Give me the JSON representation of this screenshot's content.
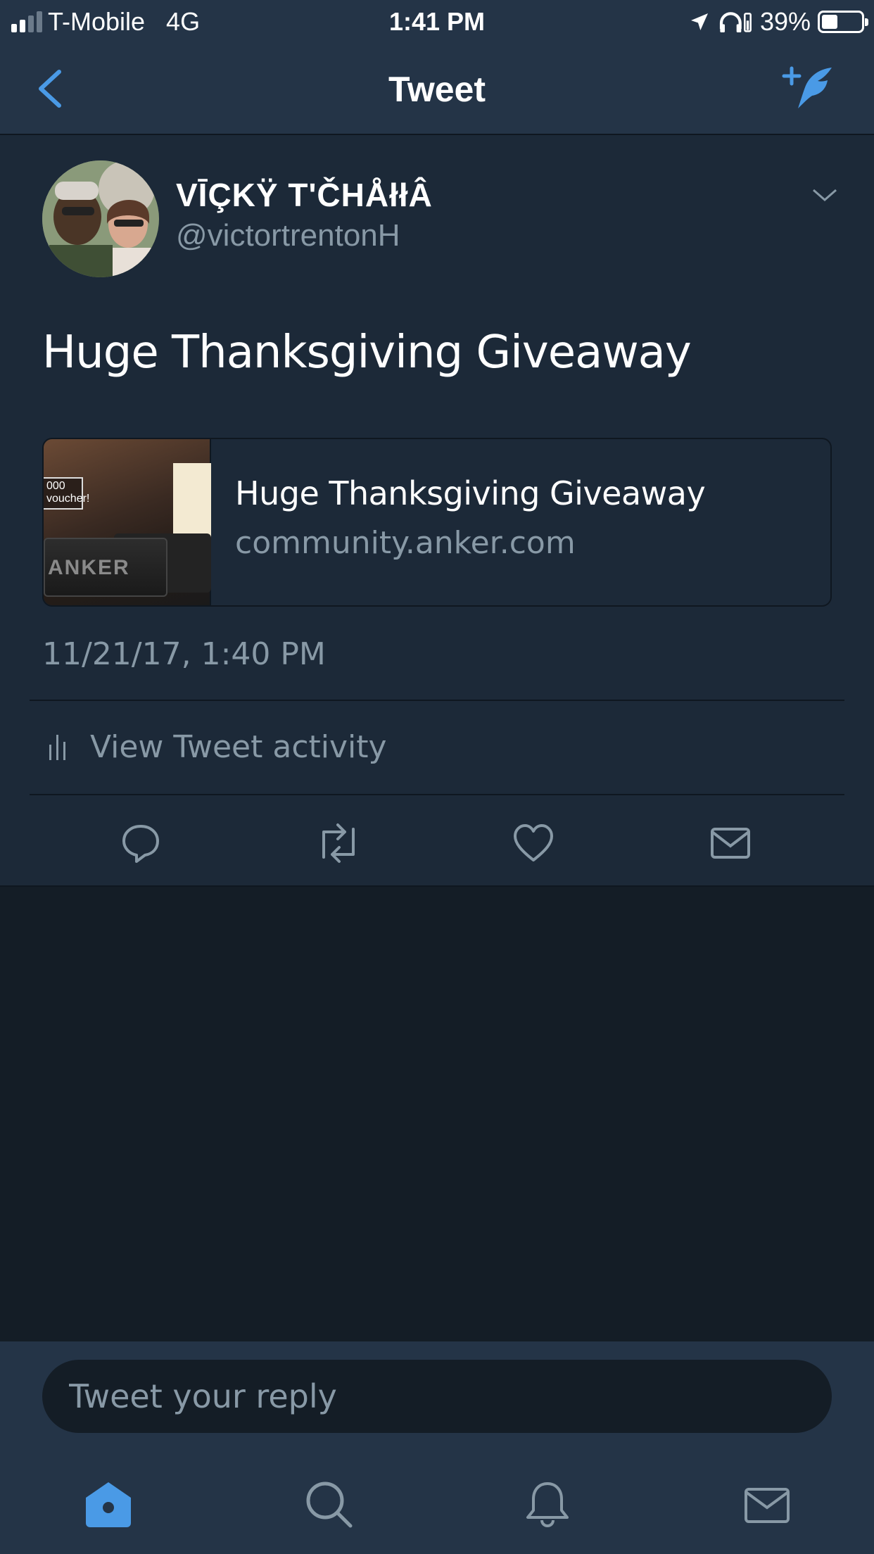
{
  "status_bar": {
    "carrier": "T-Mobile",
    "network": "4G",
    "time": "1:41 PM",
    "battery": "39%"
  },
  "nav": {
    "title": "Tweet"
  },
  "tweet": {
    "display_name": "VĪÇKŸ T'ČHÅłłÂ",
    "handle": "@victortrentonH",
    "text": "Huge Thanksgiving Giveaway",
    "timestamp": "11/21/17, 1:40 PM",
    "card": {
      "title": "Huge Thanksgiving Giveaway",
      "domain": "community.anker.com",
      "thumbnail_text": {
        "badge": "000 voucher!",
        "brand": "ANKER"
      }
    },
    "activity_label": "View Tweet activity"
  },
  "reply": {
    "placeholder": "Tweet your reply"
  },
  "icons": {
    "back": "chevron-left-icon",
    "compose": "compose-tweet-icon",
    "caret": "chevron-down-icon",
    "reply": "reply-icon",
    "retweet": "retweet-icon",
    "like": "heart-icon",
    "message": "mail-icon",
    "tabs": [
      "home-icon",
      "search-icon",
      "notifications-icon",
      "messages-icon"
    ]
  },
  "colors": {
    "accent": "#4a9ae6",
    "background": "#141d26",
    "panel": "#1c2938",
    "bar": "#243447",
    "secondary_text": "#8899a6"
  }
}
